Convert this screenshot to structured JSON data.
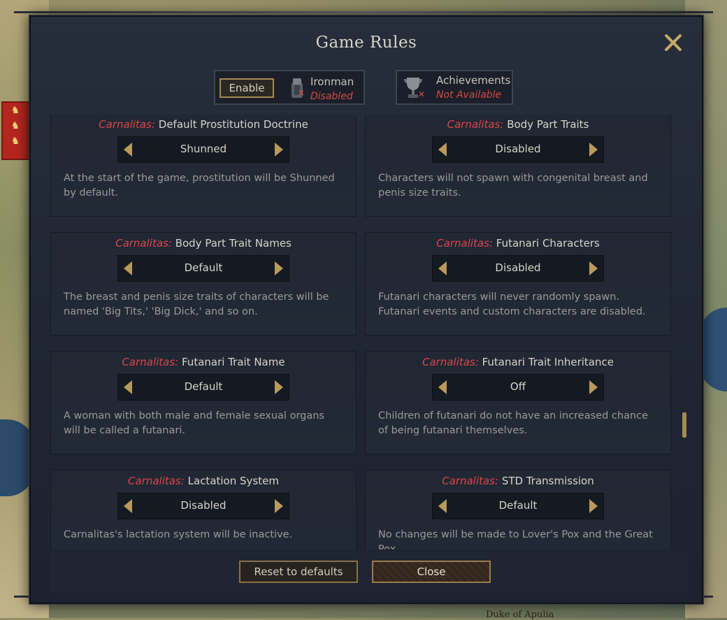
{
  "dialog": {
    "title": "Game Rules",
    "enable_label": "Enable",
    "ironman": {
      "label": "Ironman",
      "status": "Disabled",
      "icon": "ironman-icon"
    },
    "achievements": {
      "label": "Achievements",
      "status": "Not Available",
      "icon": "trophy-icon"
    },
    "colors": {
      "accent": "#a68a52",
      "warning": "#d24a40",
      "prefix": "#d8474b"
    }
  },
  "rules": [
    {
      "prefix": "Carnalitas:",
      "name": "Default Prostitution Doctrine",
      "value": "Shunned",
      "description": "At the start of the game, prostitution will be Shunned by default."
    },
    {
      "prefix": "Carnalitas:",
      "name": "Body Part Traits",
      "value": "Disabled",
      "description": "Characters will not spawn with congenital breast and penis size traits."
    },
    {
      "prefix": "Carnalitas:",
      "name": "Body Part Trait Names",
      "value": "Default",
      "description": "The breast and penis size traits of characters will be named 'Big Tits,' 'Big Dick,' and so on."
    },
    {
      "prefix": "Carnalitas:",
      "name": "Futanari Characters",
      "value": "Disabled",
      "description": "Futanari characters will never randomly spawn. Futanari events and custom characters are disabled."
    },
    {
      "prefix": "Carnalitas:",
      "name": "Futanari Trait Name",
      "value": "Default",
      "description": "A woman with both male and female sexual organs will be called a futanari."
    },
    {
      "prefix": "Carnalitas:",
      "name": "Futanari Trait Inheritance",
      "value": "Off",
      "description": "Children of futanari do not have an increased chance of being futanari themselves."
    },
    {
      "prefix": "Carnalitas:",
      "name": "Lactation System",
      "value": "Disabled",
      "description": "Carnalitas's lactation system will be inactive."
    },
    {
      "prefix": "Carnalitas:",
      "name": "STD Transmission",
      "value": "Default",
      "description": "No changes will be made to Lover's Pox and the Great Pox."
    }
  ],
  "buttons": {
    "reset": "Reset to defaults",
    "close": "Close"
  },
  "map": {
    "label": "Duke of Apulia"
  }
}
